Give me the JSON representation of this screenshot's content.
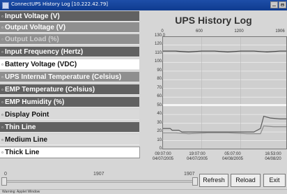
{
  "window": {
    "title": "ConnectUPS History Log [10.222.42.79]"
  },
  "menu": {
    "items": [
      {
        "label": "Input Voltage (V)",
        "style": "dark"
      },
      {
        "label": "Output Voltage (V)",
        "style": "mid"
      },
      {
        "label": "Output Load (%)",
        "style": "mid-dim"
      },
      {
        "label": "Input Frequency (Hertz)",
        "style": "dark"
      },
      {
        "label": "Battery Voltage (VDC)",
        "style": "white"
      },
      {
        "label": "UPS Internal Temperature (Celsius)",
        "style": "mid"
      },
      {
        "label": "EMP Temperature (Celsius)",
        "style": "dark"
      },
      {
        "label": "EMP Humidity (%)",
        "style": "dark"
      },
      {
        "label": "Display Point",
        "style": "light"
      },
      {
        "label": "Thin Line",
        "style": "dark"
      },
      {
        "label": "Medium Line",
        "style": "light"
      },
      {
        "label": "Thick Line",
        "style": "selected"
      }
    ]
  },
  "chart": {
    "title": "UPS History Log",
    "top_axis_ticks": [
      "0",
      "600",
      "1200",
      "1906"
    ],
    "y_ticks": [
      "130.0",
      "120.0",
      "110.0",
      "100.0",
      "90.0",
      "80.0",
      "70.0",
      "60.0",
      "50.0",
      "40.0",
      "30.0",
      "20.0",
      "10.0",
      "0.0"
    ],
    "bottom_axis_ticks": [
      {
        "time": "09:07:00",
        "date": "04/07/2005"
      },
      {
        "time": "19:07:00",
        "date": "04/07/2005"
      },
      {
        "time": "05:07:00",
        "date": "04/08/2005"
      },
      {
        "time": "16:53:00",
        "date": "04/08/20"
      }
    ]
  },
  "chart_data": {
    "type": "line",
    "title": "UPS History Log",
    "xlim": [
      0,
      1906
    ],
    "ylim": [
      0,
      130
    ],
    "grid": true,
    "series": [
      {
        "color": "#3a3a3a",
        "x": [
          0,
          200,
          400,
          600,
          800,
          1000,
          1200,
          1400,
          1600,
          1800,
          1906
        ],
        "y": [
          113,
          113,
          112,
          113,
          113,
          112,
          113,
          113,
          112,
          113,
          113
        ]
      },
      {
        "color": "#ffffff",
        "x": [
          0,
          300,
          600,
          900,
          1200,
          1500,
          1800,
          1906
        ],
        "y": [
          51,
          51,
          51,
          51,
          51,
          51,
          51,
          51
        ]
      },
      {
        "color": "#5a5a5a",
        "x": [
          0,
          120,
          150,
          250,
          300,
          500,
          800,
          1100,
          1400,
          1500,
          1550,
          1650,
          1800,
          1906
        ],
        "y": [
          24,
          24,
          22,
          22,
          20,
          20,
          20,
          20,
          20,
          24,
          38,
          36,
          35,
          35
        ]
      },
      {
        "color": "#8a8a8a",
        "x": [
          0,
          200,
          400,
          700,
          1000,
          1300,
          1500,
          1550,
          1700,
          1906
        ],
        "y": [
          19,
          19,
          18,
          19,
          19,
          18,
          18,
          27,
          26,
          26
        ]
      }
    ]
  },
  "controls": {
    "slider": {
      "min_label": "0",
      "value_label": "1907",
      "max_label": "1907"
    },
    "buttons": {
      "refresh": "Refresh",
      "reload": "Reload",
      "exit": "Exit"
    }
  },
  "status_bar": {
    "text": "Warning: Applet Window"
  }
}
